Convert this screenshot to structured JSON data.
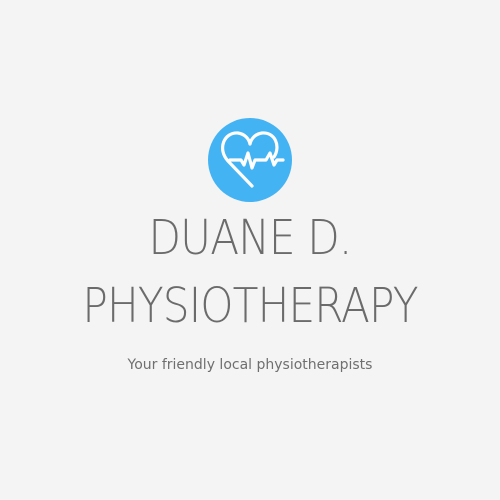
{
  "logo": {
    "icon": "heart-pulse-icon",
    "badge_color": "#44b3f4",
    "icon_color": "#ffffff"
  },
  "title": {
    "line1": "DUANE D.",
    "line2": "PHYSIOTHERAPY"
  },
  "tagline": "Your friendly local physiotherapists",
  "colors": {
    "background": "#f4f4f5",
    "text": "#6b6b6b"
  }
}
